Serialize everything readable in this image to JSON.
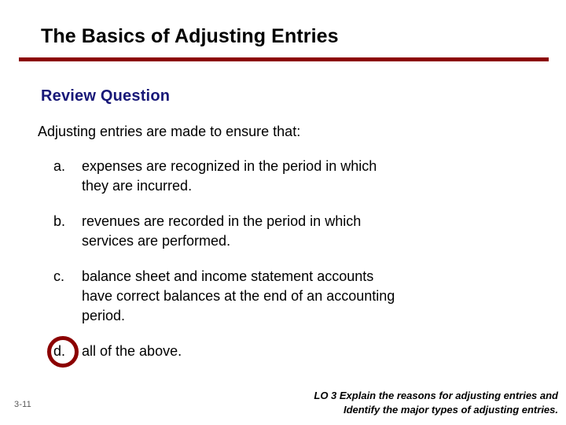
{
  "slide": {
    "title": "The Basics of Adjusting Entries",
    "page_number": "3-11",
    "accent_color": "#8b0000",
    "heading_color": "#181878",
    "background_color": "#ffffff"
  },
  "review": {
    "heading": "Review Question",
    "stem": "Adjusting entries are made to ensure that:"
  },
  "options": [
    {
      "marker": "a.",
      "lines": [
        "expenses are recognized in the period in which",
        "they are incurred."
      ],
      "circled": false
    },
    {
      "marker": "b.",
      "lines": [
        "revenues are recorded in the period in which",
        "services are performed."
      ],
      "circled": false
    },
    {
      "marker": "c.",
      "lines": [
        "balance sheet and income statement accounts",
        "have correct balances at the end of an accounting",
        "period."
      ],
      "circled": false
    },
    {
      "marker": "d.",
      "lines": [
        "all of the above."
      ],
      "circled": true
    }
  ],
  "footer": {
    "line1": "LO 3  Explain the reasons for adjusting entries and",
    "line2": "Identify the major types of adjusting entries."
  }
}
